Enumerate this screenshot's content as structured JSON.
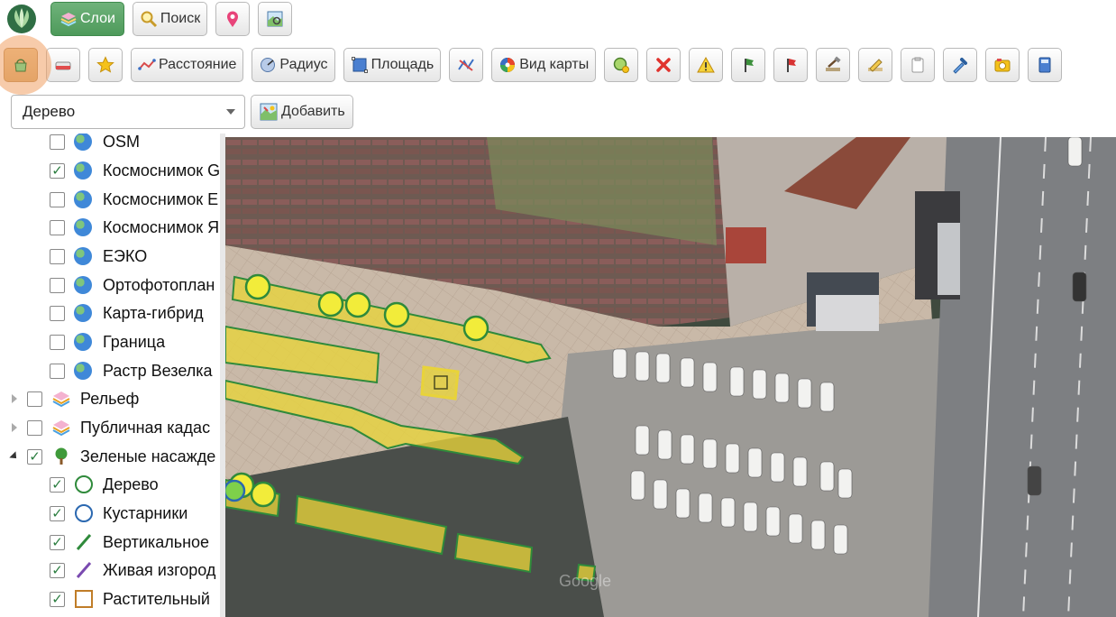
{
  "toolbar_main": {
    "layers_label": "Слои",
    "search_label": "Поиск"
  },
  "toolbar_tools": {
    "distance_label": "Расстояние",
    "radius_label": "Радиус",
    "area_label": "Площадь",
    "map_view_label": "Вид карты"
  },
  "object_selector": {
    "selected_value": "Дерево",
    "add_label": "Добавить"
  },
  "layers": {
    "items": [
      {
        "label": "OSM",
        "checked": false
      },
      {
        "label": "Космоснимок G",
        "checked": true
      },
      {
        "label": "Космоснимок E",
        "checked": false
      },
      {
        "label": "Космоснимок Я",
        "checked": false
      },
      {
        "label": "ЕЭКО",
        "checked": false
      },
      {
        "label": "Ортофотоплан",
        "checked": false
      },
      {
        "label": "Карта-гибрид",
        "checked": false
      },
      {
        "label": "Граница",
        "checked": false
      },
      {
        "label": "Растр Везелка",
        "checked": false
      },
      {
        "label": "Рельеф",
        "checked": false
      },
      {
        "label": "Публичная кадас",
        "checked": false
      },
      {
        "label": "Зеленые насажде",
        "checked": true
      },
      {
        "label": "Дерево",
        "checked": true
      },
      {
        "label": "Кустарники",
        "checked": true
      },
      {
        "label": "Вертикальное",
        "checked": true
      },
      {
        "label": "Живая изгород",
        "checked": true
      },
      {
        "label": "Растительный",
        "checked": true
      }
    ]
  },
  "map": {
    "attribution": "Google",
    "polygon_fill": "#e8d33a",
    "polygon_stroke": "#2f8a3b",
    "point_fill": "#f2ec3a"
  },
  "colors": {
    "accent_green": "#4e9a5b",
    "highlight": "#f0a064"
  }
}
